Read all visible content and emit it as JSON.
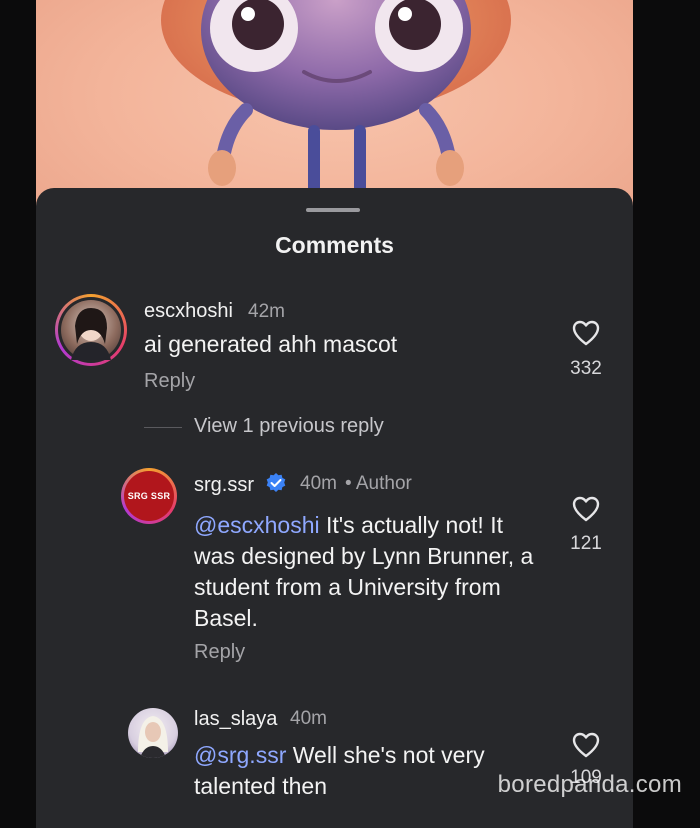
{
  "sheet": {
    "title": "Comments"
  },
  "comments": [
    {
      "username": "escxhoshi",
      "time": "42m",
      "text": "ai generated ahh mascot",
      "reply_label": "Reply",
      "likes": "332"
    },
    {
      "username": "srg.ssr",
      "time": "40m",
      "author_tag": "• Author",
      "mention": "@escxhoshi",
      "text_lines": [
        "It's actually not! It",
        "was designed by Lynn Brunner, a",
        "student from a University from",
        "Basel."
      ],
      "avatar_text": "SRG SSR",
      "reply_label": "Reply",
      "likes": "121"
    },
    {
      "username": "las_slaya",
      "time": "40m",
      "mention": "@srg.ssr",
      "text_lines": [
        "Well she's not very",
        "talented then"
      ],
      "likes": "109"
    }
  ],
  "thread": {
    "view_previous": "View 1 previous reply"
  },
  "watermark": "boredpanda.com",
  "colors": {
    "sheet": "#27282b",
    "mention": "#8fa8ff",
    "verified": "#3b82f6",
    "srg_red": "#b1161c"
  },
  "icons": [
    "heart-icon",
    "verified-badge-icon"
  ]
}
